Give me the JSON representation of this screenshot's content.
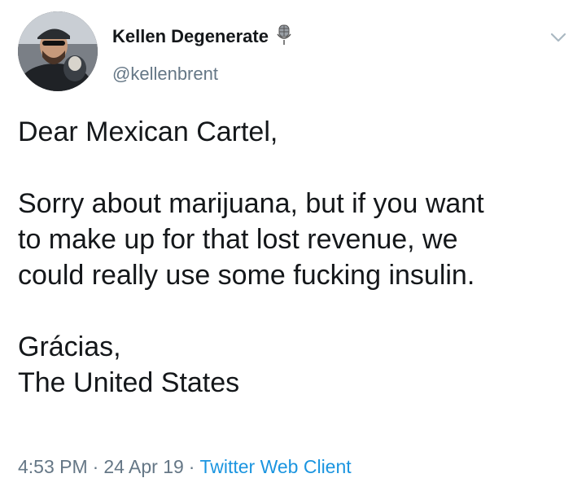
{
  "user": {
    "display_name": "Kellen Degenerate",
    "name_emoji": "microphone-icon",
    "handle": "@kellenbrent"
  },
  "tweet": {
    "lines": [
      "Dear Mexican Cartel,",
      "",
      "Sorry about marijuana, but if you want",
      "to make up for that lost revenue, we",
      "could really use some fucking insulin.",
      "",
      "Grácias,",
      "The United States"
    ]
  },
  "meta": {
    "time": "4:53 PM",
    "separator": "·",
    "date": "24 Apr 19",
    "client": "Twitter Web Client"
  },
  "colors": {
    "text": "#14171a",
    "secondary": "#657786",
    "link": "#1b95e0",
    "background": "#ffffff"
  }
}
